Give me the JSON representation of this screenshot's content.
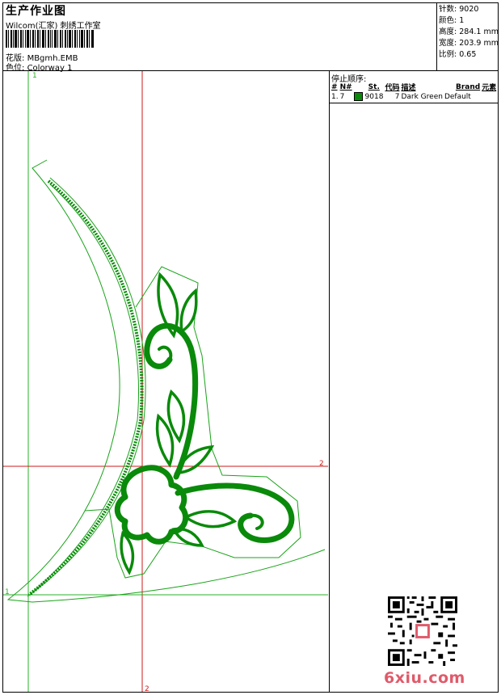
{
  "header": {
    "title": "生产作业图",
    "company": "Wilcom(汇家) 刺绣工作室",
    "design_label": "花版:",
    "design_value": "MBgmh.EMB",
    "colorway_label": "色位:",
    "colorway_value": "Colorway 1"
  },
  "meta": [
    {
      "label": "针数:",
      "value": "9020"
    },
    {
      "label": "颜色:",
      "value": "1"
    },
    {
      "label": "高度:",
      "value": "284.1 mm"
    },
    {
      "label": "宽度:",
      "value": "203.9 mm"
    },
    {
      "label": "比例:",
      "value": "0.65"
    }
  ],
  "stop_sequence": {
    "title": "停止顺序:",
    "columns": [
      "#",
      "N#",
      "St.",
      "代码",
      "描述",
      "Brand",
      "元素"
    ],
    "rows": [
      {
        "index": "1.",
        "needle": "7",
        "color": "#0a8a0a",
        "stitches": "9018",
        "code": "7",
        "description": "Dark Green",
        "brand": "Default",
        "element": ""
      }
    ]
  },
  "guides": {
    "vertical_label": "1",
    "horizontal_label": "2",
    "vertical_label_2": "2",
    "horizontal_label_1": "1"
  },
  "colors": {
    "thread": "#0a8a0a",
    "outline": "#19a319",
    "guide_red": "#cc1a1a",
    "guide_green": "#2ab02a",
    "watermark": "#e05a6a"
  },
  "watermark": {
    "text": "6xiu.com"
  }
}
